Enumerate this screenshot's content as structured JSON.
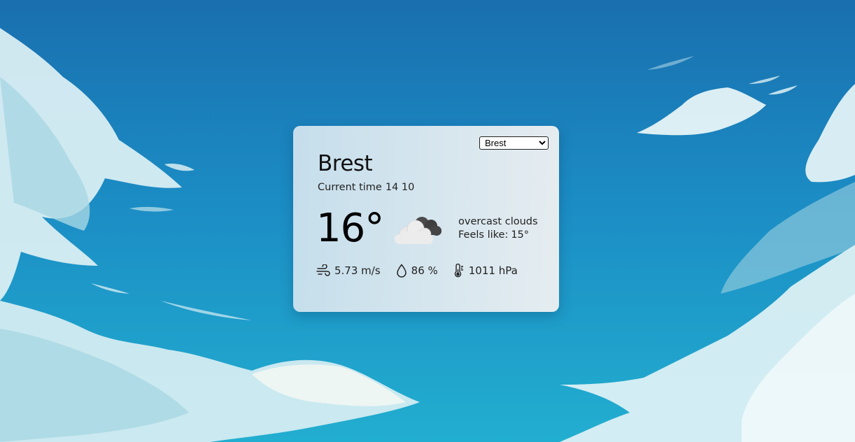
{
  "city_select": {
    "selected": "Brest",
    "options": [
      "Brest"
    ]
  },
  "weather": {
    "city": "Brest",
    "time_label": "Current time",
    "time_value": "14 10",
    "temperature": "16°",
    "icon": "overcast-clouds-icon",
    "description": "overcast clouds",
    "feels_like_label": "Feels like:",
    "feels_like_value": "15°"
  },
  "metrics": {
    "wind": {
      "icon": "wind-icon",
      "value": "5.73 m/s"
    },
    "humidity": {
      "icon": "droplet-icon",
      "value": "86 %"
    },
    "pressure": {
      "icon": "thermometer-icon",
      "value": "1011 hPa"
    }
  },
  "colors": {
    "sky_top": "#1a6fae",
    "sky_bottom": "#22aed0",
    "card_left": "#cbe1ed",
    "card_right": "#e9eef1"
  }
}
